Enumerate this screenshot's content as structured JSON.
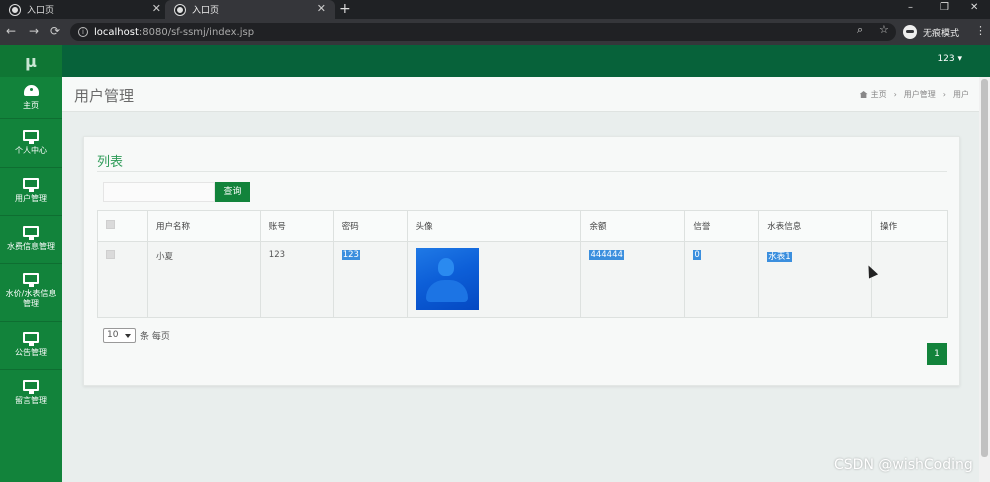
{
  "browser": {
    "tabs": [
      {
        "title": "入口页"
      },
      {
        "title": "入口页"
      }
    ],
    "new_tab": "+",
    "window_controls": [
      "–",
      "❐",
      "✕"
    ],
    "nav": {
      "back": "←",
      "forward": "→",
      "reload": "⟳"
    },
    "url_host": "localhost",
    "url_path": ":8080/sf-ssmj/index.jsp",
    "incognito_label": "无痕模式"
  },
  "app": {
    "logo": "μ",
    "user_menu": "123 ▾",
    "sidebar": [
      {
        "label": "主页",
        "icon": "gauge-icon"
      },
      {
        "label": "个人中心",
        "icon": "monitor-icon"
      },
      {
        "label": "用户管理",
        "icon": "monitor-icon"
      },
      {
        "label": "水费信息管理",
        "icon": "monitor-icon"
      },
      {
        "label": "水价/水表信息管理",
        "icon": "monitor-icon"
      },
      {
        "label": "公告管理",
        "icon": "monitor-icon"
      },
      {
        "label": "留言管理",
        "icon": "monitor-icon"
      }
    ]
  },
  "header": {
    "title": "用户管理",
    "breadcrumb": [
      "主页",
      "用户管理",
      "用户"
    ]
  },
  "card": {
    "title": "列表",
    "search_button": "查询",
    "search_value": "",
    "columns": [
      "用户名称",
      "账号",
      "密码",
      "头像",
      "余额",
      "信誉",
      "水表信息",
      "操作"
    ],
    "row": {
      "name": "小夏",
      "account": "123",
      "password": "123",
      "balance": "444444",
      "credit": "0",
      "meter": "水表1",
      "actions": ""
    },
    "page_size": "10",
    "page_size_suffix": "条 每页",
    "current_page": "1"
  },
  "watermark": "CSDN @wishCoding",
  "colors": {
    "sidebar": "#12833b",
    "topbar": "#07623a",
    "accent": "#2e9b58",
    "selection": "#3b8fde"
  }
}
